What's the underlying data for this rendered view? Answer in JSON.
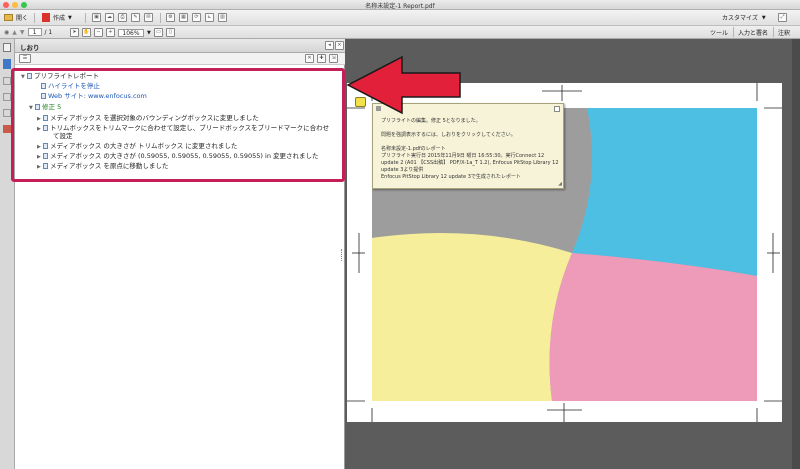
{
  "window": {
    "title": "名称未設定-1 Report.pdf"
  },
  "toolbar": {
    "open_label": "開く",
    "create_label": "作成",
    "customize_label": "カスタマイズ",
    "page_current": "1",
    "page_total": "/ 1",
    "zoom_value": "106%",
    "tools_label": "ツール",
    "sign_label": "入力と署名",
    "comment_label": "注釈"
  },
  "panel": {
    "title": "しおり",
    "bookmarks": {
      "root": "プリフライトレポート",
      "stop_highlight": "ハイライトを停止",
      "website": "Web サイト: www.enfocus.com",
      "fix": "修正 5",
      "items": [
        "メディアボックス を選択対象のバウンディングボックスに変更しました",
        "トリムボックスをトリムマークに合わせて設定し、ブリードボックスをブリードマークに合わせ",
        "て設定",
        "メディアボックス の大きさが トリムボックス に変更されました",
        "メディアボックス の大きさが (0.59055, 0.59055, 0.59055, 0.59055) in 変更されました",
        "メディアボックス を原点に移動しました"
      ]
    }
  },
  "note": {
    "line1": "プリフライトの編集。修正 5となりました。",
    "line2": "問題を強調表示するには、しおりをクリックしてください。",
    "line3": "名称未設定-1.pdfのレポート",
    "line4": "プリフライト実行日 2015年11月9日 曜日 16:55:30。実行Connect 12",
    "line5": "update 2 (A01 【CSS出稿】 PDF/X-1a_T 1.2), Enfocus PitStop Library 12",
    "line6": "update 3より提供",
    "line7": "Enfocus PitStop Library 12 update 3で生成されたレポート"
  },
  "colors": {
    "highlight_border": "#c41f58",
    "arrow": "#e3203a",
    "cyan": "#4dbfe3",
    "pink": "#ee9bba",
    "yellow": "#f6ee9a",
    "gray": "#9d9d9d"
  }
}
